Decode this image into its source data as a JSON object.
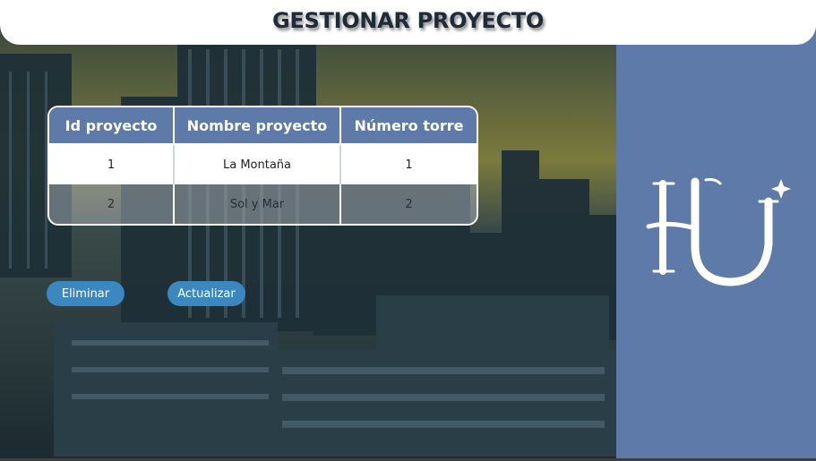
{
  "header": {
    "title": "GESTIONAR PROYECTO"
  },
  "table": {
    "columns": [
      "Id proyecto",
      "Nombre proyecto",
      "Número torre"
    ],
    "rows": [
      [
        "1",
        "La Montaña",
        "1"
      ],
      [
        "2",
        "Sol y Mar",
        "2"
      ]
    ]
  },
  "actions": {
    "delete_label": "Eliminar",
    "update_label": "Actualizar"
  },
  "colors": {
    "accent": "#5e7aa8",
    "button": "#3b87c0",
    "header_bg": "#ffffff"
  },
  "logo": {
    "name": "hu-monogram-logo"
  }
}
